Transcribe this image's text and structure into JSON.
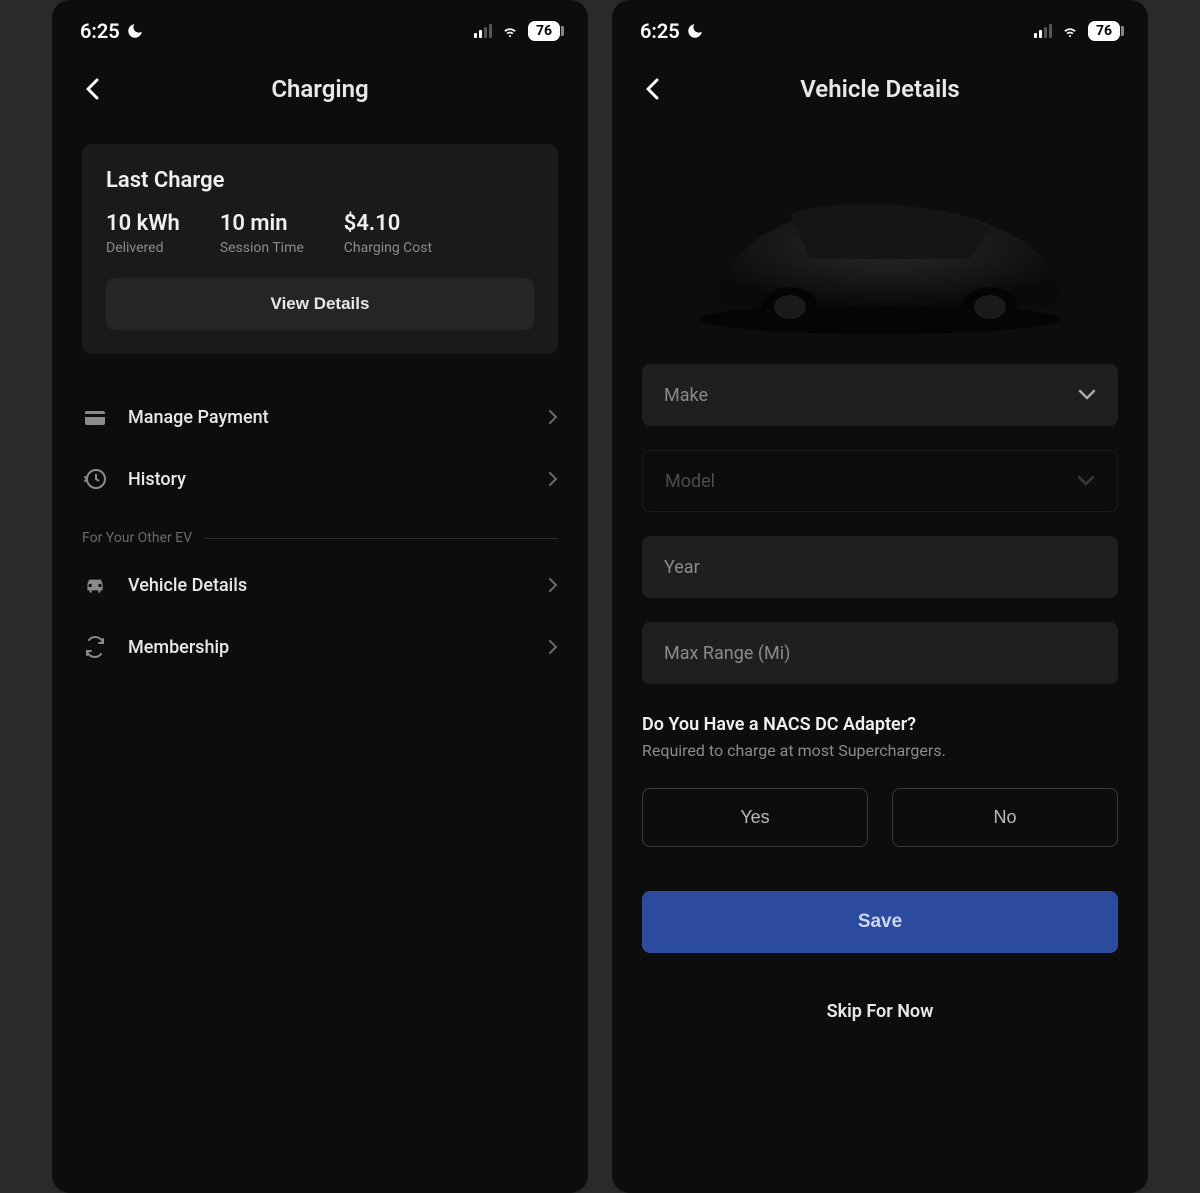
{
  "status": {
    "time": "6:25",
    "battery": "76"
  },
  "left": {
    "title": "Charging",
    "card": {
      "title": "Last Charge",
      "stats": [
        {
          "value": "10 kWh",
          "label": "Delivered"
        },
        {
          "value": "10 min",
          "label": "Session Time"
        },
        {
          "value": "$4.10",
          "label": "Charging Cost"
        }
      ],
      "viewDetails": "View Details"
    },
    "menu": {
      "managePayment": "Manage Payment",
      "history": "History",
      "sectionLabel": "For Your Other EV",
      "vehicleDetails": "Vehicle Details",
      "membership": "Membership"
    }
  },
  "right": {
    "title": "Vehicle Details",
    "fields": {
      "make": "Make",
      "model": "Model",
      "year": "Year",
      "maxRange": "Max Range (Mi)"
    },
    "adapter": {
      "question": "Do You Have a NACS DC Adapter?",
      "sub": "Required to charge at most Superchargers.",
      "yes": "Yes",
      "no": "No"
    },
    "save": "Save",
    "skip": "Skip For Now"
  }
}
